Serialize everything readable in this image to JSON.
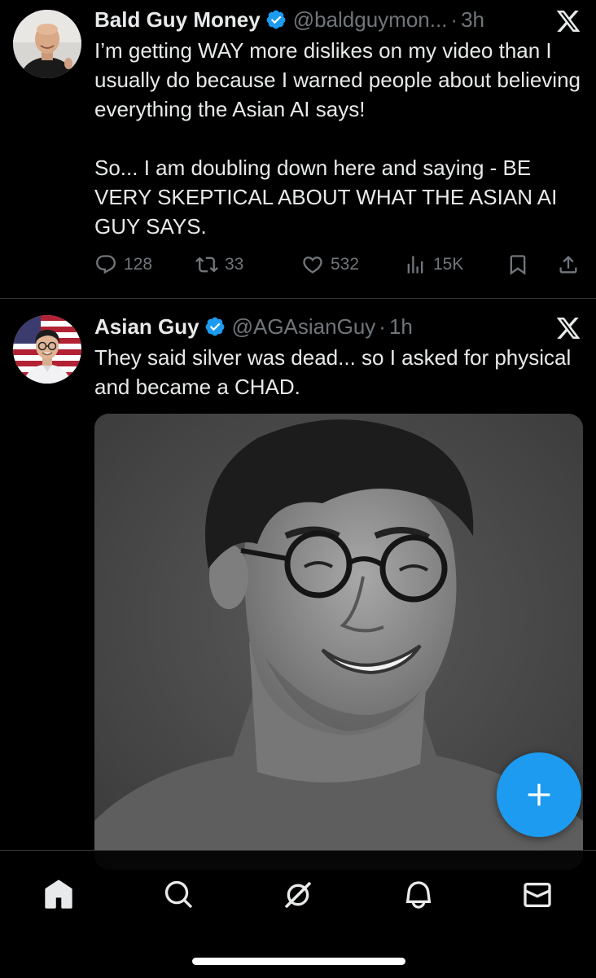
{
  "tweets": [
    {
      "display_name": "Bald Guy Money",
      "handle": "@baldguymon...",
      "separator": "·",
      "time": "3h",
      "text_paragraphs": [
        "I’m getting WAY more dislikes on my video than I usually do because I warned people about believing everything the Asian AI says!",
        "So... I am doubling down here and saying - BE VERY SKEPTICAL ABOUT WHAT THE ASIAN AI GUY SAYS."
      ],
      "stats": {
        "replies": "128",
        "reposts": "33",
        "likes": "532",
        "views": "15K"
      }
    },
    {
      "display_name": "Asian Guy",
      "handle": "@AGAsianGuy",
      "separator": "·",
      "time": "1h",
      "text_paragraphs": [
        "They said silver was dead... so I asked for physical and became a CHAD."
      ]
    }
  ],
  "icons": {
    "verified": "verified-badge-icon",
    "platform": "x-logo-icon",
    "reply": "reply-icon",
    "repost": "repost-icon",
    "like": "heart-icon",
    "views": "views-icon",
    "bookmark": "bookmark-icon",
    "share": "share-icon",
    "compose": "plus-icon"
  },
  "bottom_nav": [
    "home-icon",
    "search-icon",
    "grok-icon",
    "bell-icon",
    "mail-icon"
  ],
  "colors": {
    "background": "#000000",
    "text": "#e7e9ea",
    "secondary_text": "#71767b",
    "accent": "#1d9bf0",
    "divider": "#2f3336"
  }
}
